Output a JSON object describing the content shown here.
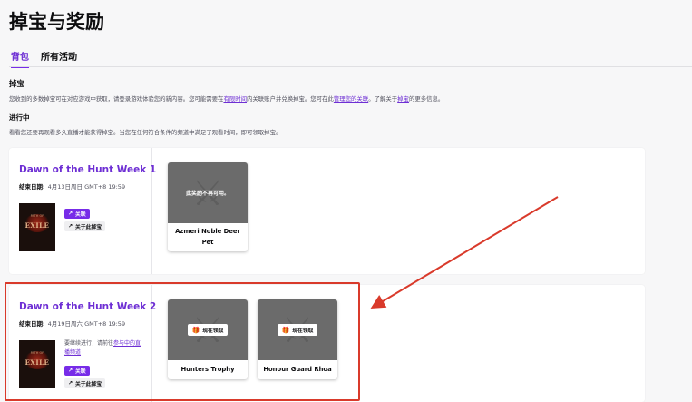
{
  "page": {
    "title": "掉宝与奖励"
  },
  "tabs": [
    {
      "label": "背包"
    },
    {
      "label": "所有活动"
    }
  ],
  "drops_section": {
    "heading": "掉宝",
    "desc_prefix": "您收到的多数掉宝可在对应游戏中获取，请登录游戏体验您的新内容。您可能需要在",
    "link_time": "有限时间",
    "desc_mid": "内关联账户并兑换掉宝。您可在此",
    "link_manage": "管理您的关联",
    "desc_mid2": "。了解关于",
    "link_drops": "掉宝",
    "desc_suffix": "的更多信息。"
  },
  "progress_section": {
    "heading": "进行中",
    "desc": "看看您还要再观看多久直播才能获得掉宝。当您在任何符合条件的频道中满足了观看时间，即可领取掉宝。"
  },
  "campaigns": [
    {
      "title": "Dawn of the Hunt Week 1",
      "end_label": "结束日期:",
      "end_value": "4月13日周日 GMT+8 19:59",
      "link_label": "关联",
      "about_label": "关于此掉宝",
      "rewards": [
        {
          "name": "Azmeri Noble Deer Pet",
          "status": "此奖励不再可用。"
        }
      ]
    },
    {
      "title": "Dawn of the Hunt Week 2",
      "end_label": "结束日期:",
      "end_value": "4月19日周六 GMT+8 19:59",
      "note_prefix": "要继续进行，请前往",
      "note_link": "参与中的直播频道",
      "link_label": "关联",
      "about_label": "关于此掉宝",
      "rewards": [
        {
          "name": "Hunters Trophy",
          "claim_label": "现在领取"
        },
        {
          "name": "Honour Guard Rhoa",
          "claim_label": "现在领取"
        }
      ]
    }
  ],
  "game_art": {
    "title": "EXILE",
    "subtitle": "PATH OF"
  },
  "colors": {
    "accent": "#772ce8",
    "annotation": "#d93a2b"
  }
}
